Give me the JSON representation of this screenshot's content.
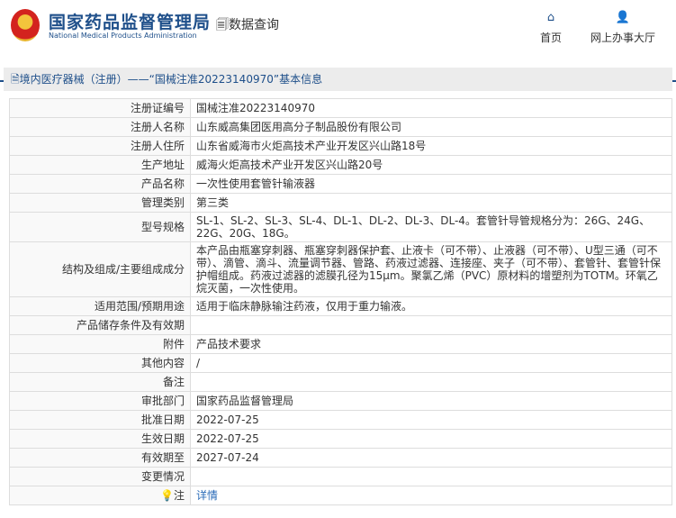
{
  "header": {
    "title_cn": "国家药品监督管理局",
    "title_en": "National Medical Products Administration",
    "data_query": "数据查询",
    "nav": [
      {
        "label": "首页",
        "icon": "home-icon"
      },
      {
        "label": "网上办事大厅",
        "icon": "user-icon"
      }
    ]
  },
  "section_title": "境内医疗器械（注册）——“国械注准20223140970”基本信息",
  "rows": [
    {
      "label": "注册证编号",
      "value": "国械注准20223140970"
    },
    {
      "label": "注册人名称",
      "value": "山东威高集团医用高分子制品股份有限公司"
    },
    {
      "label": "注册人住所",
      "value": "山东省威海市火炬高技术产业开发区兴山路18号"
    },
    {
      "label": "生产地址",
      "value": "威海火炬高技术产业开发区兴山路20号"
    },
    {
      "label": "产品名称",
      "value": "一次性使用套管针输液器"
    },
    {
      "label": "管理类别",
      "value": "第三类"
    },
    {
      "label": "型号规格",
      "value": "SL-1、SL-2、SL-3、SL-4、DL-1、DL-2、DL-3、DL-4。套管针导管规格分为：26G、24G、22G、20G、18G。"
    },
    {
      "label": "结构及组成/主要组成成分",
      "value": "本产品由瓶塞穿刺器、瓶塞穿刺器保护套、止液卡（可不带）、止液器（可不带）、U型三通（可不带）、滴管、滴斗、流量调节器、管路、药液过滤器、连接座、夹子（可不带）、套管针、套管针保护帽组成。药液过滤器的滤膜孔径为15μm。聚氯乙烯（PVC）原材料的增塑剂为TOTM。环氧乙烷灭菌，一次性使用。"
    },
    {
      "label": "适用范围/预期用途",
      "value": "适用于临床静脉输注药液，仅用于重力输液。"
    },
    {
      "label": "产品储存条件及有效期",
      "value": ""
    },
    {
      "label": "附件",
      "value": "产品技术要求"
    },
    {
      "label": "其他内容",
      "value": "/"
    },
    {
      "label": "备注",
      "value": ""
    },
    {
      "label": "审批部门",
      "value": "国家药品监督管理局"
    },
    {
      "label": "批准日期",
      "value": "2022-07-25"
    },
    {
      "label": "生效日期",
      "value": "2022-07-25"
    },
    {
      "label": "有效期至",
      "value": "2027-07-24"
    },
    {
      "label": "变更情况",
      "value": ""
    }
  ],
  "note": {
    "label": "注",
    "link": "详情"
  }
}
